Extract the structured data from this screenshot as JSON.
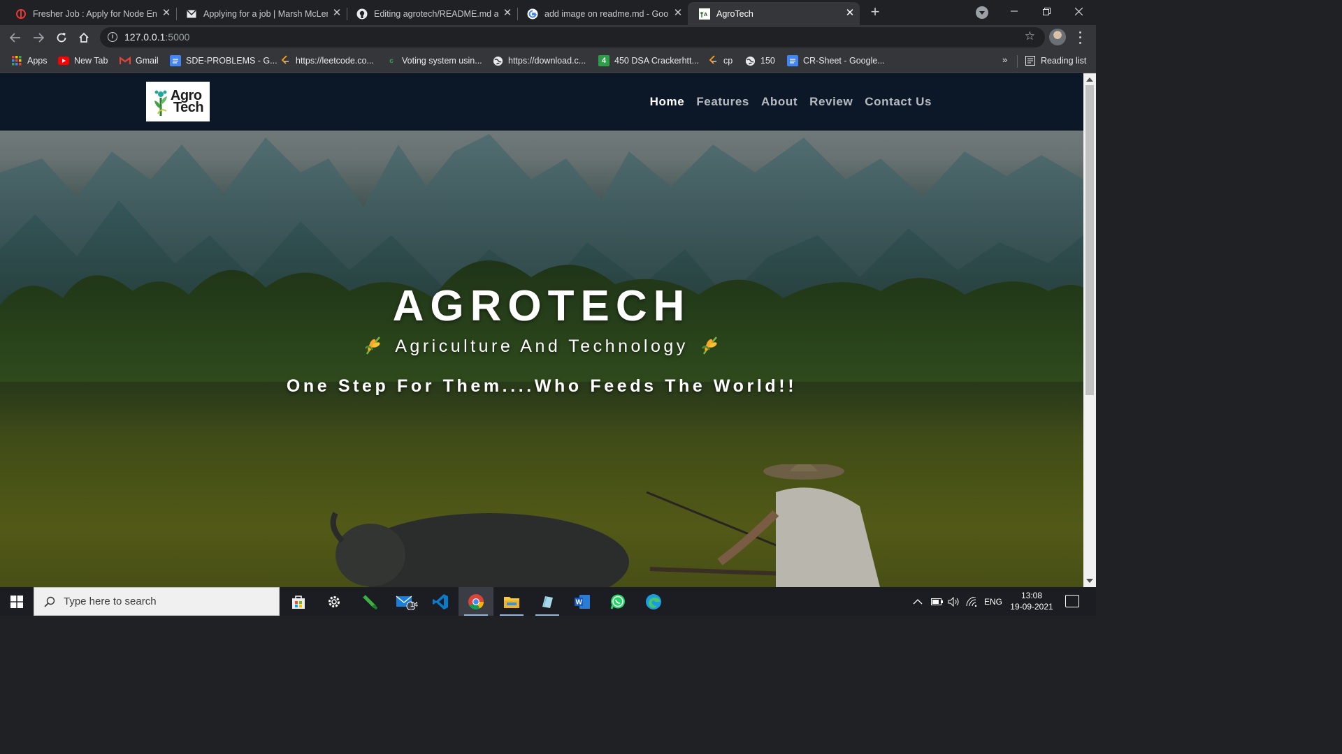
{
  "browser": {
    "tabs": [
      {
        "title": "Fresher Job : Apply for Node Eng",
        "icon": "job-site-icon",
        "active": false
      },
      {
        "title": "Applying for a job | Marsh McLen",
        "icon": "mail-icon",
        "active": false
      },
      {
        "title": "Editing agrotech/README.md at",
        "icon": "github-icon",
        "active": false
      },
      {
        "title": "add image on readme.md - Goo",
        "icon": "google-icon",
        "active": false
      },
      {
        "title": "AgroTech",
        "icon": "agrotech-favicon",
        "active": true
      }
    ],
    "new_tab_label": "+",
    "url_host": "127.0.0.1",
    "url_port": ":5000",
    "bookmarks": [
      {
        "label": "Apps",
        "icon": "apps-grid-icon"
      },
      {
        "label": "New Tab",
        "icon": "youtube-icon"
      },
      {
        "label": "Gmail",
        "icon": "gmail-icon"
      },
      {
        "label": "SDE-PROBLEMS - G...",
        "icon": "google-docs-icon"
      },
      {
        "label": "https://leetcode.co...",
        "icon": "leetcode-icon"
      },
      {
        "label": "Voting system usin...",
        "icon": "c-site-icon"
      },
      {
        "label": "https://download.c...",
        "icon": "globe-icon"
      },
      {
        "label": "450 DSA Crackerhtt...",
        "icon": "green-4-icon"
      },
      {
        "label": "cp",
        "icon": "leetcode-icon"
      },
      {
        "label": "150",
        "icon": "globe-icon"
      },
      {
        "label": "CR-Sheet - Google...",
        "icon": "google-docs-icon"
      }
    ],
    "bookmarks_overflow": "»",
    "reading_list": "Reading list"
  },
  "site": {
    "logo_line1": "Agro",
    "logo_line2": "Tech",
    "nav": [
      {
        "label": "Home",
        "active": true
      },
      {
        "label": "Features",
        "active": false
      },
      {
        "label": "About",
        "active": false
      },
      {
        "label": "Review",
        "active": false
      },
      {
        "label": "Contact Us",
        "active": false
      }
    ],
    "hero_title": "AGROTECH",
    "hero_subtitle": "Agriculture And Technology",
    "hero_subtitle_icon": "wheat-icon",
    "hero_tagline": "One Step For Them....Who Feeds The World!!"
  },
  "taskbar": {
    "search_placeholder": "Type here to search",
    "mail_badge": "14",
    "language": "ENG",
    "time": "13:08",
    "date": "19-09-2021"
  },
  "colors": {
    "navbar_bg": "#0c1828",
    "nav_active": "#ffffff",
    "nav_inactive": "#b8bcc2",
    "chrome_dark": "#202124",
    "chrome_toolbar": "#35363a"
  }
}
